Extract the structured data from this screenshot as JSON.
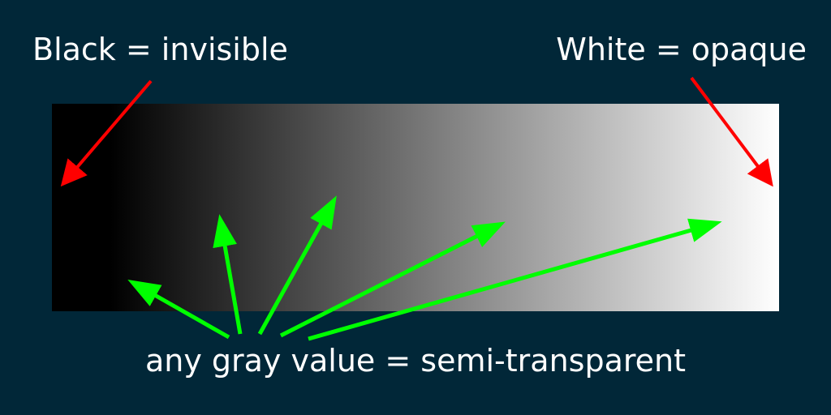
{
  "colors": {
    "background": "#012738",
    "text": "#ffffff",
    "red_arrow": "#ff0000",
    "green_arrow": "#00ff00",
    "gradient_start": "#000000",
    "gradient_end": "#ffffff"
  },
  "labels": {
    "black": "Black = invisible",
    "white": "White = opaque",
    "gray": "any gray value = semi-transparent"
  }
}
